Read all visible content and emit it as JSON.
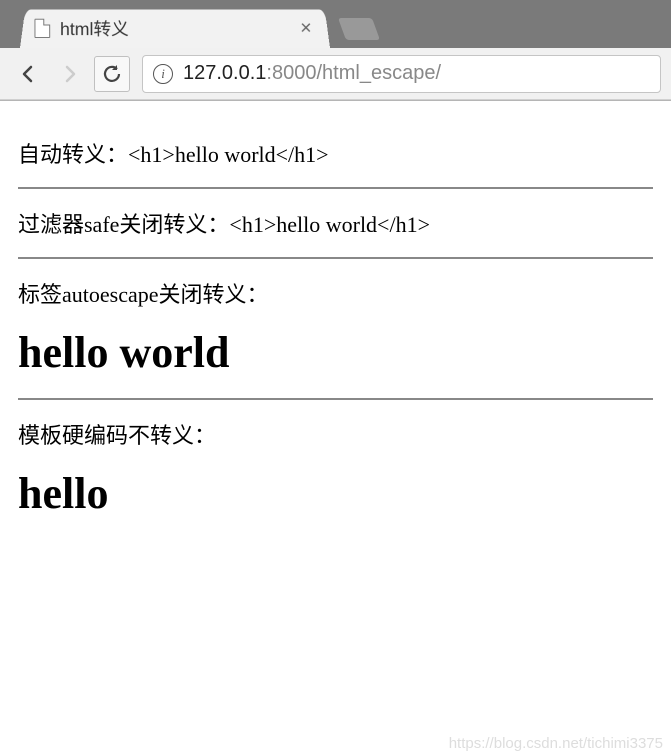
{
  "browser": {
    "tab_title": "html转义",
    "url_host": "127.0.0.1",
    "url_port": ":8000",
    "url_path": "/html_escape/"
  },
  "content": {
    "line1_label": "自动转义：",
    "line1_value": "<h1>hello world</h1>",
    "line2_label": "过滤器safe关闭转义：",
    "line2_value": "<h1>hello world</h1>",
    "line3_label": "标签autoescape关闭转义：",
    "line3_heading": "hello world",
    "line4_label": "模板硬编码不转义：",
    "line4_heading": "hello"
  },
  "watermark": "https://blog.csdn.net/tichimi3375"
}
